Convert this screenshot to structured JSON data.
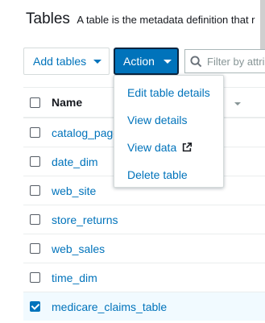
{
  "header": {
    "title": "Tables",
    "description": "A table is the metadata definition that r"
  },
  "toolbar": {
    "add_tables_label": "Add tables",
    "action_label": "Action",
    "filter_placeholder": "Filter by attri"
  },
  "action_menu": {
    "items": [
      {
        "label": "Edit table details"
      },
      {
        "label": "View details"
      },
      {
        "label": "View data",
        "icon": "external-link-icon"
      },
      {
        "label": "Delete table"
      }
    ]
  },
  "table": {
    "column_header": "Name",
    "rows": [
      {
        "name": "catalog_page",
        "checked": false
      },
      {
        "name": "date_dim",
        "checked": false
      },
      {
        "name": "web_site",
        "checked": false
      },
      {
        "name": "store_returns",
        "checked": false
      },
      {
        "name": "web_sales",
        "checked": false
      },
      {
        "name": "time_dim",
        "checked": false
      },
      {
        "name": "medicare_claims_table",
        "checked": true
      }
    ]
  },
  "colors": {
    "accent": "#0073bb",
    "text": "#16191f",
    "selected_row": "#f1faff"
  }
}
